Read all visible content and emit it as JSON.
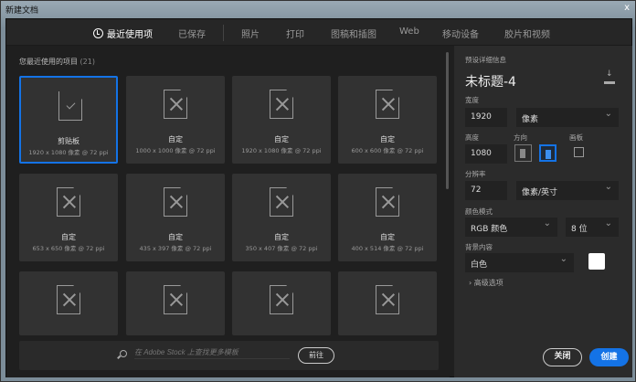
{
  "window": {
    "title": "新建文档",
    "close": "x"
  },
  "tabs": [
    {
      "label": "最近使用项",
      "active": true
    },
    {
      "label": "已保存"
    },
    {
      "label": "照片"
    },
    {
      "label": "打印"
    },
    {
      "label": "图稿和插图"
    },
    {
      "label": "Web"
    },
    {
      "label": "移动设备"
    },
    {
      "label": "胶片和视频"
    }
  ],
  "recent": {
    "title": "您最近使用的项目",
    "count": "(21)",
    "items": [
      {
        "name": "剪贴板",
        "size": "1920 x 1080 像素 @ 72 ppi",
        "icon": "clipboard-icon",
        "selected": true
      },
      {
        "name": "自定",
        "size": "1000 x 1000 像素 @ 72 ppi",
        "icon": "custom-doc-icon"
      },
      {
        "name": "自定",
        "size": "1920 x 1080 像素 @ 72 ppi",
        "icon": "custom-doc-icon"
      },
      {
        "name": "自定",
        "size": "600 x 600 像素 @ 72 ppi",
        "icon": "custom-doc-icon"
      },
      {
        "name": "自定",
        "size": "653 x 650 像素 @ 72 ppi",
        "icon": "custom-doc-icon"
      },
      {
        "name": "自定",
        "size": "435 x 397 像素 @ 72 ppi",
        "icon": "custom-doc-icon"
      },
      {
        "name": "自定",
        "size": "350 x 407 像素 @ 72 ppi",
        "icon": "custom-doc-icon"
      },
      {
        "name": "自定",
        "size": "400 x 514 像素 @ 72 ppi",
        "icon": "custom-doc-icon"
      }
    ]
  },
  "search": {
    "placeholder": "在 Adobe Stock 上查找更多模板",
    "go": "前往"
  },
  "details": {
    "header": "预设详细信息",
    "doc_title": "未标题-4",
    "width_label": "宽度",
    "width": "1920",
    "width_unit": "像素",
    "height_label": "高度",
    "height": "1080",
    "orientation_label": "方向",
    "orientation": "landscape",
    "artboard_label": "画板",
    "artboard": false,
    "resolution_label": "分辨率",
    "resolution": "72",
    "resolution_unit": "像素/英寸",
    "color_mode_label": "颜色模式",
    "color_mode": "RGB 颜色",
    "bit_depth": "8 位",
    "background_label": "背景内容",
    "background": "白色",
    "background_color": "#ffffff",
    "advanced": "高级选项"
  },
  "buttons": {
    "close": "关闭",
    "create": "创建"
  },
  "colors": {
    "accent": "#1473e6"
  }
}
